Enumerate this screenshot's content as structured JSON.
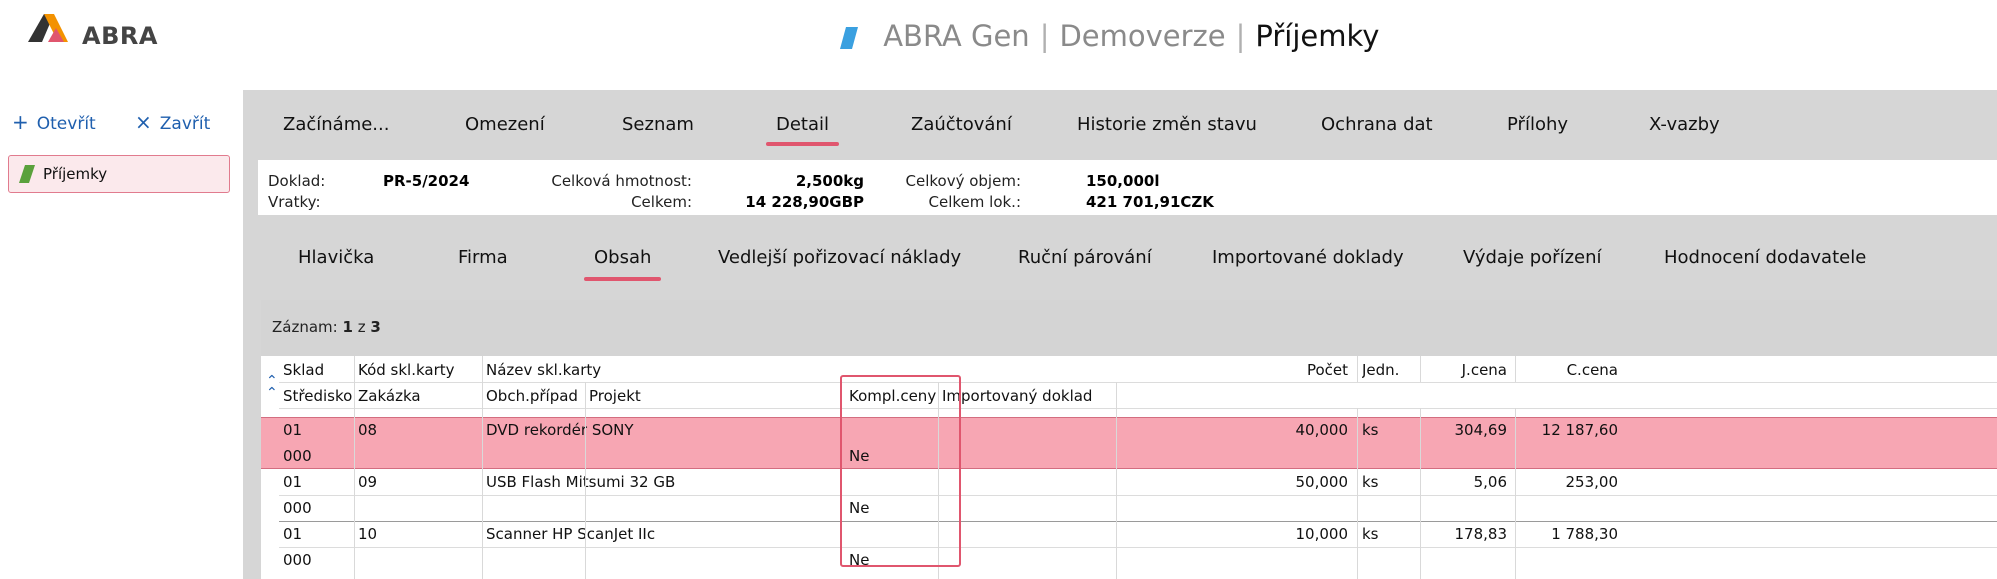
{
  "brand": {
    "logo_text": "ABRA",
    "accent": "#e0566e",
    "link": "#1f5fae"
  },
  "header": {
    "app": "ABRA Gen",
    "edition": "Demoverze",
    "module": "Příjemky",
    "separator": "|"
  },
  "leftpanel": {
    "open_label": "Otevřít",
    "open_icon": "+",
    "close_label": "Zavřít",
    "close_icon": "×",
    "items": [
      {
        "label": "Příjemky"
      }
    ]
  },
  "tabs_main": [
    "Začínáme...",
    "Omezení",
    "Seznam",
    "Detail",
    "Zaúčtování",
    "Historie změn stavu",
    "Ochrana dat",
    "Přílohy",
    "X-vazby"
  ],
  "tabs_main_active": "Detail",
  "info": {
    "doklad_label": "Doklad:",
    "doklad": "PR-5/2024",
    "vratky_label": "Vratky:",
    "hmotnost_label": "Celková hmotnost:",
    "hmotnost": "2,500kg",
    "celkem_label": "Celkem:",
    "celkem": "14 228,90GBP",
    "objem_label": "Celkový objem:",
    "objem": "150,000l",
    "celkem_lok_label": "Celkem lok.:",
    "celkem_lok": "421 701,91CZK"
  },
  "tabs_sub": [
    "Hlavička",
    "Firma",
    "Obsah",
    "Vedlejší pořizovací náklady",
    "Ruční párování",
    "Importované doklady",
    "Výdaje pořízení",
    "Hodnocení dodavatele"
  ],
  "tabs_sub_active": "Obsah",
  "grid": {
    "zaznam_label": "Záznam:",
    "zaznam_current": "1",
    "zaznam_of": "z",
    "zaznam_total": "3",
    "headers_row1": {
      "sklad": "Sklad",
      "kod": "Kód skl.karty",
      "nazev": "Název skl.karty",
      "pocet": "Počet",
      "jedn": "Jedn.",
      "jcena": "J.cena",
      "ccena": "C.cena"
    },
    "headers_row2": {
      "stredisko": "Středisko",
      "zakazka": "Zakázka",
      "obch": "Obch.případ",
      "projekt": "Projekt",
      "kompl": "Kompl.ceny",
      "import": "Importovaný doklad"
    },
    "rows": [
      {
        "sklad": "01",
        "kod": "08",
        "nazev": "DVD rekordér SONY",
        "pocet": "40,000",
        "jedn": "ks",
        "jcena": "304,69",
        "ccena": "12 187,60",
        "stredisko": "000",
        "kompl": "Ne"
      },
      {
        "sklad": "01",
        "kod": "09",
        "nazev": "USB Flash Mitsumi 32 GB",
        "pocet": "50,000",
        "jedn": "ks",
        "jcena": "5,06",
        "ccena": "253,00",
        "stredisko": "000",
        "kompl": "Ne"
      },
      {
        "sklad": "01",
        "kod": "10",
        "nazev": "Scanner HP ScanJet IIc",
        "pocet": "10,000",
        "jedn": "ks",
        "jcena": "178,83",
        "ccena": "1 788,30",
        "stredisko": "000",
        "kompl": "Ne"
      }
    ]
  }
}
